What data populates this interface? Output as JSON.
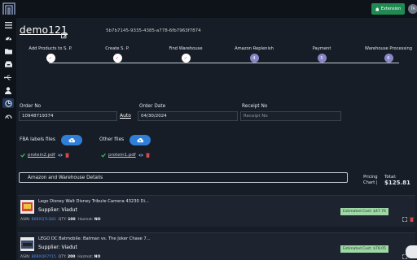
{
  "topbar": {
    "extension_label": "Extension",
    "avatar_initials": "TA"
  },
  "sidebar": {
    "items": [
      {
        "icon": "menu-icon"
      },
      {
        "icon": "dashboard-gauge-icon"
      },
      {
        "icon": "folder-icon"
      },
      {
        "icon": "inbox-icon"
      },
      {
        "icon": "usb-icon"
      },
      {
        "icon": "user-icon"
      },
      {
        "icon": "orders-icon",
        "active": true
      },
      {
        "icon": "speedometer-icon"
      }
    ]
  },
  "order": {
    "title": "demo121",
    "uuid": "5b7b7145-9335-4385-a778-6fb7963f7874"
  },
  "steps": [
    {
      "label": "Add Products to S. P.",
      "status": "done",
      "mark": "✓"
    },
    {
      "label": "Create S. P.",
      "status": "done",
      "mark": "✓"
    },
    {
      "label": "Find Warehouse",
      "status": "done",
      "mark": "✓"
    },
    {
      "label": "Amazon Replenish",
      "status": "todo",
      "mark": "4"
    },
    {
      "label": "Payment",
      "status": "todo",
      "mark": "5"
    },
    {
      "label": "Warehouse Processing",
      "status": "todo",
      "mark": "6"
    }
  ],
  "form": {
    "order_no_label": "Order No",
    "order_no_value": "10948719374",
    "auto_label": "Auto",
    "order_date_label": "Order Date",
    "order_date_value": "04/30/2024",
    "receipt_no_label": "Receipt No",
    "receipt_no_placeholder": "Receipt No"
  },
  "files": {
    "fba_label": "FBA labels files",
    "fba_file": "protein2.pdf",
    "other_label": "Other files",
    "other_file": "protein1.pdf"
  },
  "details": {
    "bar_label": "Amazon and Warehouse Details",
    "pricing_line1": "Pricing",
    "pricing_line2": "Chart",
    "separator": "|",
    "total_label": "Total:",
    "total_amount": "$125.81"
  },
  "products": [
    {
      "title": "Lego Disney Walt Disney Tribute Camera 43230 Di...",
      "supplier": "Supplier: Viadut",
      "asin_label": "ASIN:",
      "asin": "B0BXQ7LQ82",
      "qty_label": "QTY:",
      "qty": "100",
      "hazmat_label": "Hazmat:",
      "hazmat": "NO",
      "est_cost": "Estimated Cost: $47.76"
    },
    {
      "title": "LEGO DC Batmobile: Batman vs. The Joker Chase 7...",
      "supplier": "Supplier: Viadut",
      "asin_label": "ASIN:",
      "asin": "B0BXQR7Y15",
      "qty_label": "QTY:",
      "qty": "200",
      "hazmat_label": "Hazmat:",
      "hazmat": "NO",
      "est_cost": "Estimated Cost: $78.05"
    }
  ],
  "colors": {
    "accent": "#2f7fd8",
    "success": "#1f8a52",
    "step_todo": "#8a84c8",
    "danger": "#e04848"
  }
}
